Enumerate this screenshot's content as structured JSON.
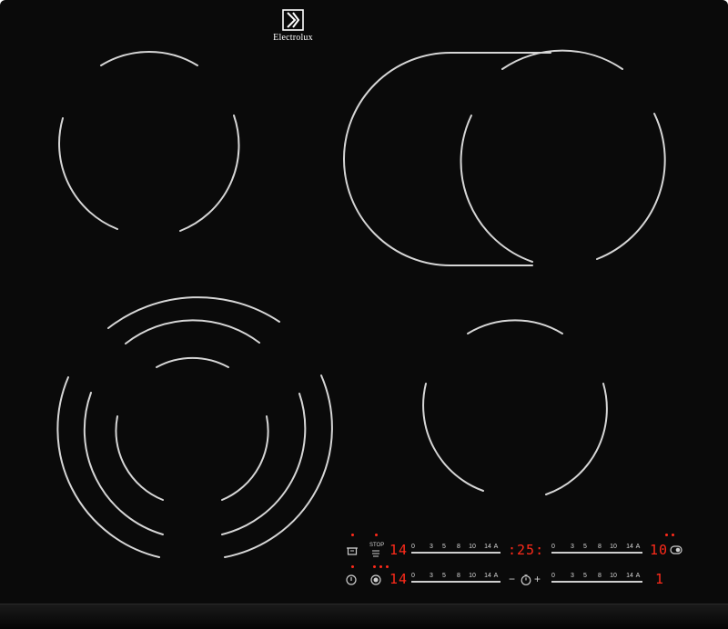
{
  "brand": {
    "name": "Electrolux"
  },
  "colors": {
    "surface": "#0a0a0a",
    "zone_lines": "#d6d6d6",
    "display_red": "#ff2a1a",
    "controls": "#cfcfcf"
  },
  "zones": [
    {
      "name": "rear-left-zone",
      "type": "single"
    },
    {
      "name": "rear-right-zone",
      "type": "oval-extendable"
    },
    {
      "name": "front-left-zone",
      "type": "triple-ring"
    },
    {
      "name": "front-right-zone",
      "type": "single"
    }
  ],
  "controls": {
    "stop_label": "STOP",
    "row1": {
      "power_level": "14",
      "timer_display": ":25:",
      "zone_level": "10"
    },
    "row2": {
      "power_level": "14",
      "zone_level": "1"
    },
    "slider_ticks": [
      "0",
      "3",
      "5",
      "8",
      "10",
      "14",
      "A"
    ],
    "timer_minus": "−",
    "timer_plus": "+",
    "icons": {
      "keep_warm": "pot-icon",
      "stop_go": "stop-icon",
      "lock": "lock-icon",
      "power": "power-icon",
      "bridge": "bridge-icon",
      "timer": "timer-icon",
      "extend": "extend-zone-icon"
    }
  }
}
